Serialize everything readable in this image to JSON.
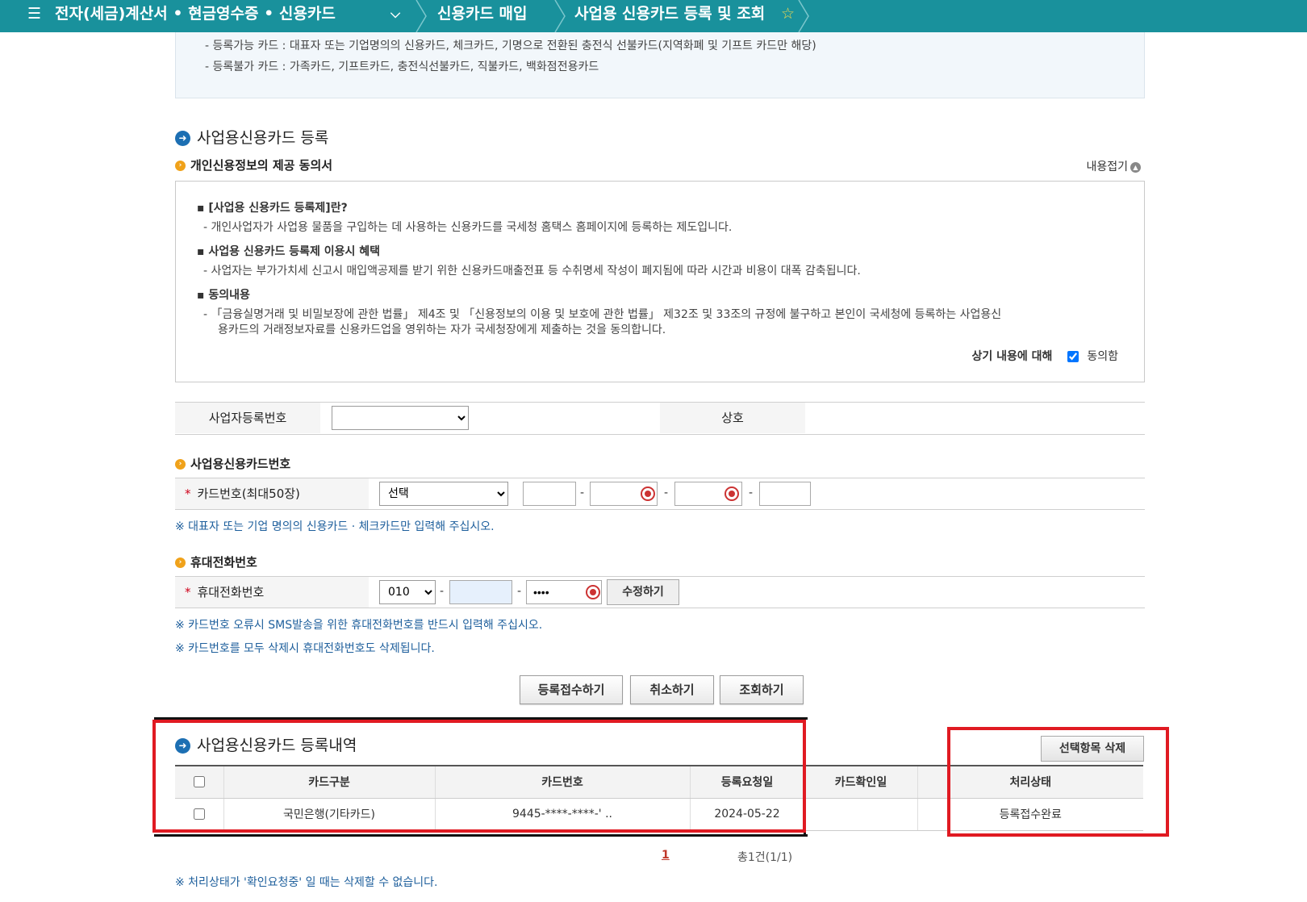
{
  "topbar": {
    "menu_label": "전자(세금)계산서 • 현금영수증 • 신용카드",
    "crumb1": "신용카드 매입",
    "crumb2": "사업용 신용카드 등록 및 조회"
  },
  "info": {
    "line1": "- 등록가능 카드 : 대표자 또는 기업명의의 신용카드, 체크카드, 기명으로 전환된 충전식 선불카드(지역화폐 및 기프트 카드만 해당)",
    "line2": "- 등록불가 카드 : 가족카드, 기프트카드, 충전식선불카드, 직불카드, 백화점전용카드"
  },
  "register": {
    "title": "사업용신용카드 등록",
    "consent_title": "개인신용정보의 제공 동의서",
    "collapse_label": "내용접기",
    "h1": "▪ [사업용 신용카드 등록제]란?",
    "t1": "- 개인사업자가 사업용 물품을 구입하는 데 사용하는 신용카드를 국세청 홈택스 홈페이지에 등록하는 제도입니다.",
    "h2": "▪ 사업용 신용카드 등록제 이용시 혜택",
    "t2": "- 사업자는 부가가치세 신고시 매입액공제를 받기 위한 신용카드매출전표 등 수취명세 작성이 폐지됨에 따라 시간과 비용이 대폭 감축됩니다.",
    "h3": "▪ 동의내용",
    "t3a": "- 「금융실명거래 및 비밀보장에 관한 법률」 제4조 및 「신용정보의 이용 및 보호에 관한 법률」 제32조 및 33조의 규정에 불구하고 본인이 국세청에 등록하는 사업용신",
    "t3b": "용카드의   거래정보자료를 신용카드업을 영위하는 자가 국세청장에게 제출하는 것을 동의합니다.",
    "agree_prefix": "상기 내용에 대해",
    "agree_label": "동의함",
    "agree_checked": true
  },
  "form": {
    "bizno_label": "사업자등록번호",
    "bizno_value": "",
    "company_label": "상호",
    "card_section": "사업용신용카드번호",
    "card_label": "카드번호(최대50장)",
    "card_select": "선택",
    "card_note": "※ 대표자 또는 기업 명의의 신용카드 · 체크카드만 입력해 주십시오.",
    "phone_section": "휴대전화번호",
    "phone_label": "휴대전화번호",
    "phone_prefix": "010",
    "phone_last": "••••",
    "edit_button": "수정하기",
    "phone_note1": "※ 카드번호 오류시 SMS발송을 위한 휴대전화번호를 반드시 입력해 주십시오.",
    "phone_note2": "※ 카드번호를 모두 삭제시 휴대전화번호도 삭제됩니다."
  },
  "actions": {
    "submit": "등록접수하기",
    "cancel": "취소하기",
    "search": "조회하기"
  },
  "history": {
    "title": "사업용신용카드 등록내역",
    "delete_button": "선택항목 삭제",
    "columns": [
      "카드구분",
      "카드번호",
      "등록요청일",
      "카드확인일",
      "처리상태"
    ],
    "rows": [
      {
        "type": "국민은행(기타카드)",
        "number": "9445-****-****-' ..",
        "request_date": "2024-05-22",
        "confirm_date": "",
        "status": "등록접수완료"
      }
    ],
    "page": "1",
    "total": "총1건(1/1)",
    "footnote": "※ 처리상태가 '확인요청중' 일 때는 삭제할 수 없습니다."
  },
  "colors": {
    "topbar": "#19919c",
    "highlight": "#e01a22",
    "link_blue": "#1e5f9c"
  }
}
